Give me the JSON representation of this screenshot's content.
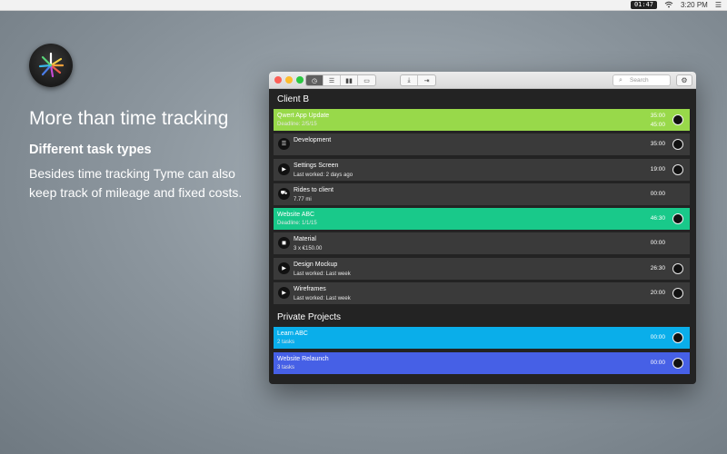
{
  "menubar": {
    "timer": "01:47",
    "time": "3:20 PM"
  },
  "hero": {
    "headline": "More than time tracking",
    "subhead": "Different task types",
    "description": "Besides time tracking Tyme can also keep track of mileage and fixed costs."
  },
  "window": {
    "search_placeholder": "Search",
    "groups": [
      {
        "name": "Client B",
        "rows": [
          {
            "kind": "project",
            "title": "Qwert App Update",
            "sub": "Deadline: 2/5/15",
            "time1": "35:00",
            "time2": "45:00",
            "color": "#98d94a"
          },
          {
            "kind": "task",
            "icon": "list-icon",
            "icon_glyph": "☰",
            "title": "Development",
            "sub": "",
            "time": "35:00",
            "has_timer": true
          },
          {
            "kind": "task",
            "icon": "play-icon",
            "icon_glyph": "▶",
            "title": "Settings Screen",
            "sub": "Last worked: 2 days ago",
            "time": "19:00",
            "has_timer": true
          },
          {
            "kind": "task",
            "icon": "car-icon",
            "icon_glyph": "⛟",
            "title": "Rides to client",
            "sub": "7.77 mi",
            "time": "00:00",
            "has_timer": false
          },
          {
            "kind": "project",
            "title": "Website ABC",
            "sub": "Deadline: 1/1/15",
            "time1": "",
            "time2": "",
            "time_mid": "46:30",
            "color": "#19c98a"
          },
          {
            "kind": "task",
            "icon": "cube-icon",
            "icon_glyph": "◼",
            "title": "Material",
            "sub": "3 x €150.00",
            "time": "00:00",
            "has_timer": false
          },
          {
            "kind": "task",
            "icon": "play-icon",
            "icon_glyph": "▶",
            "title": "Design Mockup",
            "sub": "Last worked: Last week",
            "time": "26:30",
            "has_timer": true
          },
          {
            "kind": "task",
            "icon": "play-icon",
            "icon_glyph": "▶",
            "title": "Wireframes",
            "sub": "Last worked: Last week",
            "time": "20:00",
            "has_timer": true
          }
        ]
      },
      {
        "name": "Private Projects",
        "rows": [
          {
            "kind": "project",
            "title": "Learn ABC",
            "sub": "2 tasks",
            "time1": "",
            "time2": "",
            "time_mid": "00:00",
            "color": "#0aaeea"
          },
          {
            "kind": "project",
            "title": "Website Relaunch",
            "sub": "3 tasks",
            "time1": "",
            "time2": "",
            "time_mid": "00:00",
            "color": "#4660e6"
          }
        ]
      }
    ]
  }
}
